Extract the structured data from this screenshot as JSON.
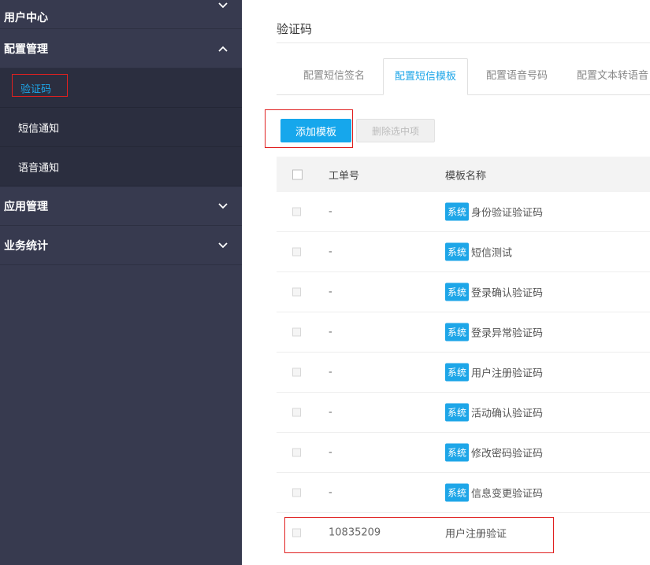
{
  "sidebar": {
    "groups": [
      {
        "label": "用户中心"
      },
      {
        "label": "配置管理",
        "items": [
          {
            "label": "验证码"
          },
          {
            "label": "短信通知"
          },
          {
            "label": "语音通知"
          }
        ]
      },
      {
        "label": "应用管理"
      },
      {
        "label": "业务统计"
      }
    ]
  },
  "page": {
    "title": "验证码",
    "tabs": [
      {
        "label": "配置短信签名"
      },
      {
        "label": "配置短信模板"
      },
      {
        "label": "配置语音号码"
      },
      {
        "label": "配置文本转语音"
      }
    ]
  },
  "toolbar": {
    "add_label": "添加模板",
    "delete_label": "删除选中项"
  },
  "table": {
    "headers": {
      "id": "工单号",
      "name": "模板名称"
    },
    "badge": "系统",
    "rows": [
      {
        "id": "-",
        "name": "身份验证验证码"
      },
      {
        "id": "-",
        "name": "短信测试"
      },
      {
        "id": "-",
        "name": "登录确认验证码"
      },
      {
        "id": "-",
        "name": "登录异常验证码"
      },
      {
        "id": "-",
        "name": "用户注册验证码"
      },
      {
        "id": "-",
        "name": "活动确认验证码"
      },
      {
        "id": "-",
        "name": "修改密码验证码"
      },
      {
        "id": "-",
        "name": "信息变更验证码"
      },
      {
        "id": "10835209",
        "name": "用户注册验证"
      }
    ]
  },
  "colors": {
    "accent": "#1ea6e8",
    "sidebar_bg": "#373a4f",
    "highlight": "#e02020"
  }
}
